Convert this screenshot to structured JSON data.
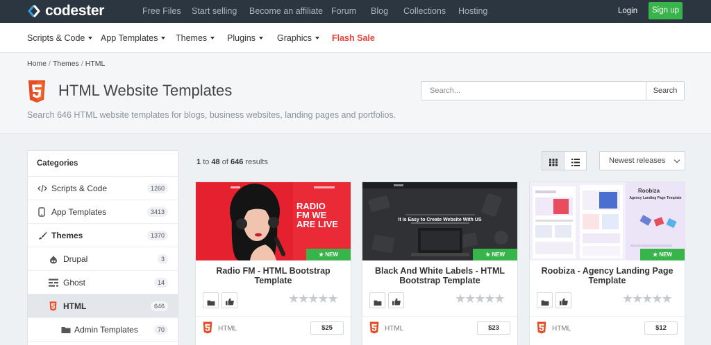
{
  "brand": {
    "name": "codester"
  },
  "topnav": {
    "links": [
      "Free Files",
      "Start selling",
      "Become an affiliate",
      "Forum",
      "Blog",
      "Collections",
      "Hosting"
    ],
    "login": "Login",
    "signup": "Sign up"
  },
  "catnav": {
    "items": [
      "Scripts & Code",
      "App Templates",
      "Themes",
      "Plugins",
      "Graphics"
    ],
    "flash": "Flash Sale",
    "flash_color": "#e8423a"
  },
  "header": {
    "breadcrumb": [
      "Home",
      "Themes",
      "HTML"
    ],
    "title": "HTML Website Templates",
    "subtitle": "Search 646 HTML website templates for blogs, business websites, landing pages and portfolios.",
    "search_placeholder": "Search...",
    "search_button": "Search"
  },
  "sidebar": {
    "heading": "Categories",
    "items": [
      {
        "label": "Scripts & Code",
        "count": "1260",
        "icon": "code-icon"
      },
      {
        "label": "App Templates",
        "count": "3413",
        "icon": "mobile-icon"
      },
      {
        "label": "Themes",
        "count": "1370",
        "icon": "brush-icon"
      },
      {
        "label": "Drupal",
        "count": "3",
        "icon": "drupal-icon"
      },
      {
        "label": "Ghost",
        "count": "14",
        "icon": "ghost-icon"
      },
      {
        "label": "HTML",
        "count": "646",
        "icon": "html5-icon"
      },
      {
        "label": "Admin Templates",
        "count": "70",
        "icon": "folder-icon"
      }
    ]
  },
  "results": {
    "from": "1",
    "to": "48",
    "total": "646",
    "to_word": "to",
    "of_word": "of",
    "suffix": "results"
  },
  "sort": {
    "selected": "Newest releases"
  },
  "cards": [
    {
      "title": "Radio FM - HTML Bootstrap Template",
      "badge": "NEW",
      "type": "HTML",
      "price": "$25",
      "thumb_text": "RADIO FM WE ARE LIVE"
    },
    {
      "title": "Black And White Labels - HTML Bootstrap Template",
      "badge": "NEW",
      "type": "HTML",
      "price": "$23",
      "thumb_text": "It is Easy to Create Website With US"
    },
    {
      "title": "Roobiza - Agency Landing Page Template",
      "badge": "NEW",
      "type": "HTML",
      "price": "$12",
      "thumb_text": "Roobiza",
      "thumb_sub": "Agency Landing Page Template"
    }
  ],
  "colors": {
    "topbar": "#2b3640",
    "accent_green": "#38b54a",
    "html5_orange": "#e44d26"
  }
}
